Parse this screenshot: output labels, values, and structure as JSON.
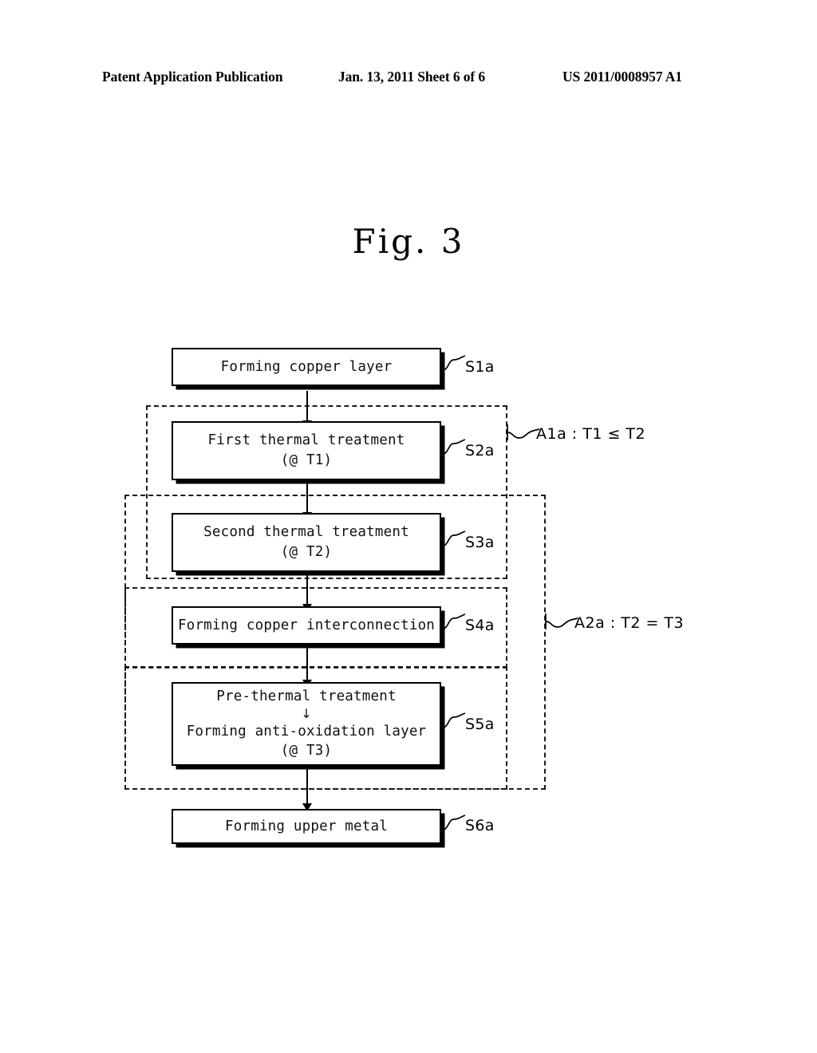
{
  "header": {
    "publication": "Patent Application Publication",
    "date_sheet": "Jan. 13, 2011   Sheet 6 of 6",
    "patent_number": "US 2011/0008957 A1"
  },
  "figure": {
    "title": "Fig. 3",
    "type": "flowchart"
  },
  "flowchart": {
    "nodes": [
      {
        "id": "S1a",
        "ref": "S1a",
        "lines": [
          "Forming copper layer"
        ],
        "has_inner_arrow": false
      },
      {
        "id": "S2a",
        "ref": "S2a",
        "lines": [
          "First thermal treatment",
          "(@ T1)"
        ],
        "has_inner_arrow": false
      },
      {
        "id": "S3a",
        "ref": "S3a",
        "lines": [
          "Second thermal treatment",
          "(@ T2)"
        ],
        "has_inner_arrow": false
      },
      {
        "id": "S4a",
        "ref": "S4a",
        "lines": [
          "Forming copper interconnection"
        ],
        "has_inner_arrow": false
      },
      {
        "id": "S5a",
        "ref": "S5a",
        "lines": [
          "Pre-thermal treatment",
          "Forming anti-oxidation layer",
          "(@ T3)"
        ],
        "inner_arrow": "↓",
        "has_inner_arrow": true
      },
      {
        "id": "S6a",
        "ref": "S6a",
        "lines": [
          "Forming upper metal"
        ],
        "has_inner_arrow": false
      }
    ],
    "groups": [
      {
        "id": "A1a",
        "label": "A1a : T1 ≤ T2",
        "encloses": [
          "S2a",
          "S3a"
        ]
      },
      {
        "id": "A2a",
        "label": "A2a : T2 = T3",
        "encloses": [
          "S3a",
          "S4a",
          "S5a"
        ]
      },
      {
        "id": "inner-S4a",
        "label": "",
        "encloses": [
          "S4a"
        ]
      },
      {
        "id": "inner-S5a",
        "label": "",
        "encloses": [
          "S5a"
        ]
      }
    ],
    "colors": {
      "line": "#000000",
      "fill": "#ffffff",
      "dashed": "#1a1a1a"
    }
  }
}
